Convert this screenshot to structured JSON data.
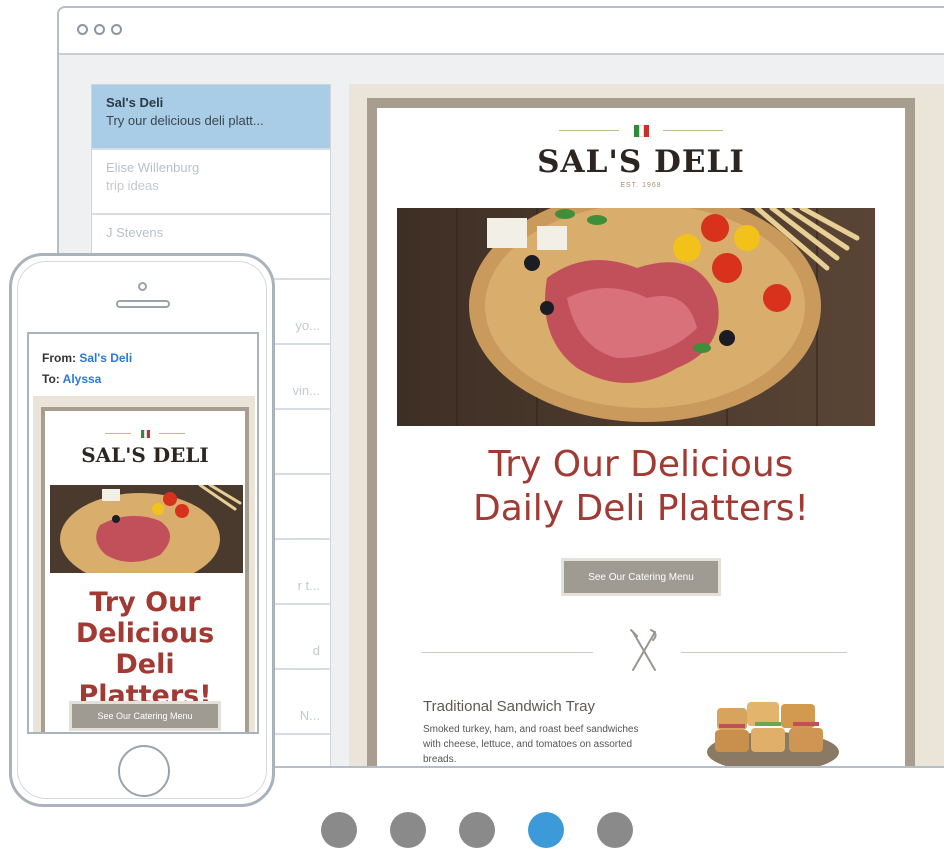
{
  "colors": {
    "selected_row": "#a9cde6",
    "headline": "#a23a34",
    "link": "#2a79d6",
    "pager_active": "#3d9ad8",
    "pager_inactive": "#8a8a8a"
  },
  "inbox": {
    "items": [
      {
        "sender": "Sal's Deli",
        "subject": "Try our delicious deli platt...",
        "selected": true
      },
      {
        "sender": "Elise Willenburg",
        "subject": "trip ideas"
      },
      {
        "sender": "J Stevens",
        "subject": ""
      },
      {
        "sender": "",
        "subject": "",
        "fragment": "yo..."
      },
      {
        "sender": "",
        "subject": "",
        "fragment": "vin..."
      },
      {
        "sender": "",
        "subject": ""
      },
      {
        "sender": "",
        "subject": ""
      },
      {
        "sender": "",
        "subject": "",
        "fragment": "r t..."
      },
      {
        "sender": "",
        "subject": "",
        "fragment": "d"
      },
      {
        "sender": "",
        "subject": "",
        "fragment": "N..."
      }
    ]
  },
  "email": {
    "brand": "SAL'S DELI",
    "established": "EST. 1968",
    "headline_line1": "Try Our Delicious",
    "headline_line2": "Daily Deli Platters!",
    "cta_label": "See Our Catering Menu",
    "section_title": "Traditional Sandwich Tray",
    "section_desc": "Smoked turkey, ham, and roast beef sandwiches with cheese, lettuce, and tomatoes on assorted breads."
  },
  "phone": {
    "from_label": "From:",
    "from_value": "Sal's Deli",
    "to_label": "To:",
    "to_value": "Alyssa",
    "brand": "SAL'S DELI",
    "headline_line1": "Try Our",
    "headline_line2": "Delicious",
    "headline_line3": "Deli Platters!",
    "cta_label": "See Our Catering Menu"
  },
  "pager": {
    "count": 5,
    "active_index": 3
  }
}
